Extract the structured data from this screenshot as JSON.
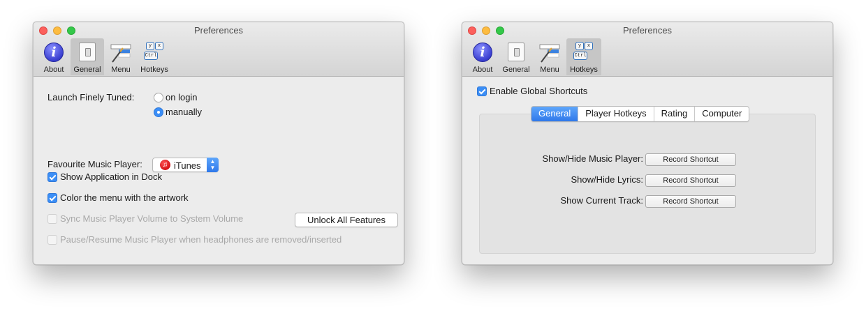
{
  "windows": [
    {
      "title": "Preferences",
      "toolbar": [
        "About",
        "General",
        "Menu",
        "Hotkeys"
      ],
      "selected_tab": "General"
    },
    {
      "title": "Preferences",
      "toolbar": [
        "About",
        "General",
        "Menu",
        "Hotkeys"
      ],
      "selected_tab": "Hotkeys"
    }
  ],
  "icons": {
    "about": "info-icon",
    "general": "switch-icon",
    "menu": "menu-icon",
    "hotkeys": "keyboard-icon",
    "hotkey_keys": [
      "y",
      "x",
      "Ctrl"
    ]
  },
  "general": {
    "launch_label": "Launch Finely Tuned:",
    "launch_options": [
      "on login",
      "manually"
    ],
    "launch_selected": "manually",
    "player_label": "Favourite Music Player:",
    "player_value": "iTunes",
    "checkboxes": [
      {
        "label": "Show Application in Dock",
        "checked": true,
        "enabled": true
      },
      {
        "label": "Color the menu with the artwork",
        "checked": true,
        "enabled": true
      },
      {
        "label": "Sync Music Player Volume to System Volume",
        "checked": false,
        "enabled": false
      },
      {
        "label": "Pause/Resume Music Player when headphones are removed/inserted",
        "checked": false,
        "enabled": false
      }
    ],
    "unlock_button": "Unlock All Features"
  },
  "hotkeys": {
    "enable_label": "Enable Global Shortcuts",
    "enable_checked": true,
    "tabs": [
      "General",
      "Player Hotkeys",
      "Rating",
      "Computer"
    ],
    "selected_tab": "General",
    "shortcuts": [
      {
        "label": "Show/Hide Music Player:",
        "button": "Record Shortcut"
      },
      {
        "label": "Show/Hide Lyrics:",
        "button": "Record Shortcut"
      },
      {
        "label": "Show Current Track:",
        "button": "Record Shortcut"
      }
    ]
  },
  "colors": {
    "accent": "#3b8ef6",
    "close": "#fc605c",
    "minimize": "#fdbc40",
    "maximize": "#34c84a"
  }
}
